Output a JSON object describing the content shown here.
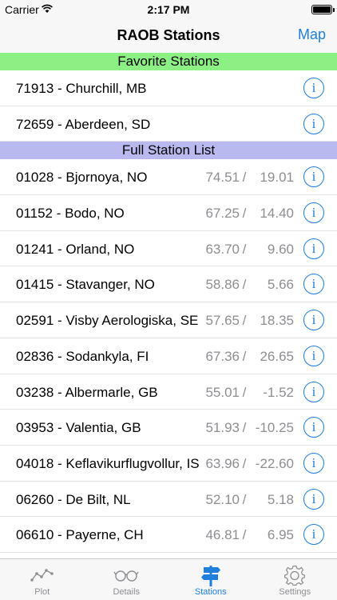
{
  "status_bar": {
    "carrier": "Carrier",
    "time": "2:17 PM"
  },
  "nav": {
    "title": "RAOB Stations",
    "map_button": "Map"
  },
  "favorites": {
    "header": "Favorite Stations",
    "items": [
      {
        "name": "71913 - Churchill, MB"
      },
      {
        "name": "72659 - Aberdeen, SD"
      }
    ]
  },
  "full_list": {
    "header": "Full Station List",
    "items": [
      {
        "name": "01028 - Bjornoya, NO",
        "lat": "74.51",
        "lon": "19.01"
      },
      {
        "name": "01152 - Bodo, NO",
        "lat": "67.25",
        "lon": "14.40"
      },
      {
        "name": "01241 - Orland, NO",
        "lat": "63.70",
        "lon": "9.60"
      },
      {
        "name": "01415 - Stavanger, NO",
        "lat": "58.86",
        "lon": "5.66"
      },
      {
        "name": "02591 - Visby Aerologiska, SE",
        "lat": "57.65",
        "lon": "18.35"
      },
      {
        "name": "02836 - Sodankyla, FI",
        "lat": "67.36",
        "lon": "26.65"
      },
      {
        "name": "03238 - Albermarle, GB",
        "lat": "55.01",
        "lon": "-1.52"
      },
      {
        "name": "03953 - Valentia, GB",
        "lat": "51.93",
        "lon": "-10.25"
      },
      {
        "name": "04018 - Keflavikurflugvollur, IS",
        "lat": "63.96",
        "lon": "-22.60"
      },
      {
        "name": "06260 - De Bilt, NL",
        "lat": "52.10",
        "lon": "5.18"
      },
      {
        "name": "06610 - Payerne, CH",
        "lat": "46.81",
        "lon": "6.95"
      }
    ]
  },
  "coord_separator": "/",
  "info_glyph": "i",
  "tabs": [
    {
      "label": "Plot",
      "icon": "plot-icon"
    },
    {
      "label": "Details",
      "icon": "glasses-icon"
    },
    {
      "label": "Stations",
      "icon": "signpost-icon"
    },
    {
      "label": "Settings",
      "icon": "gear-icon"
    }
  ],
  "colors": {
    "accent": "#1f7fdc",
    "favorites_header": "#8cf084",
    "full_list_header": "#b9b9f0",
    "secondary_text": "#8e8e93"
  }
}
